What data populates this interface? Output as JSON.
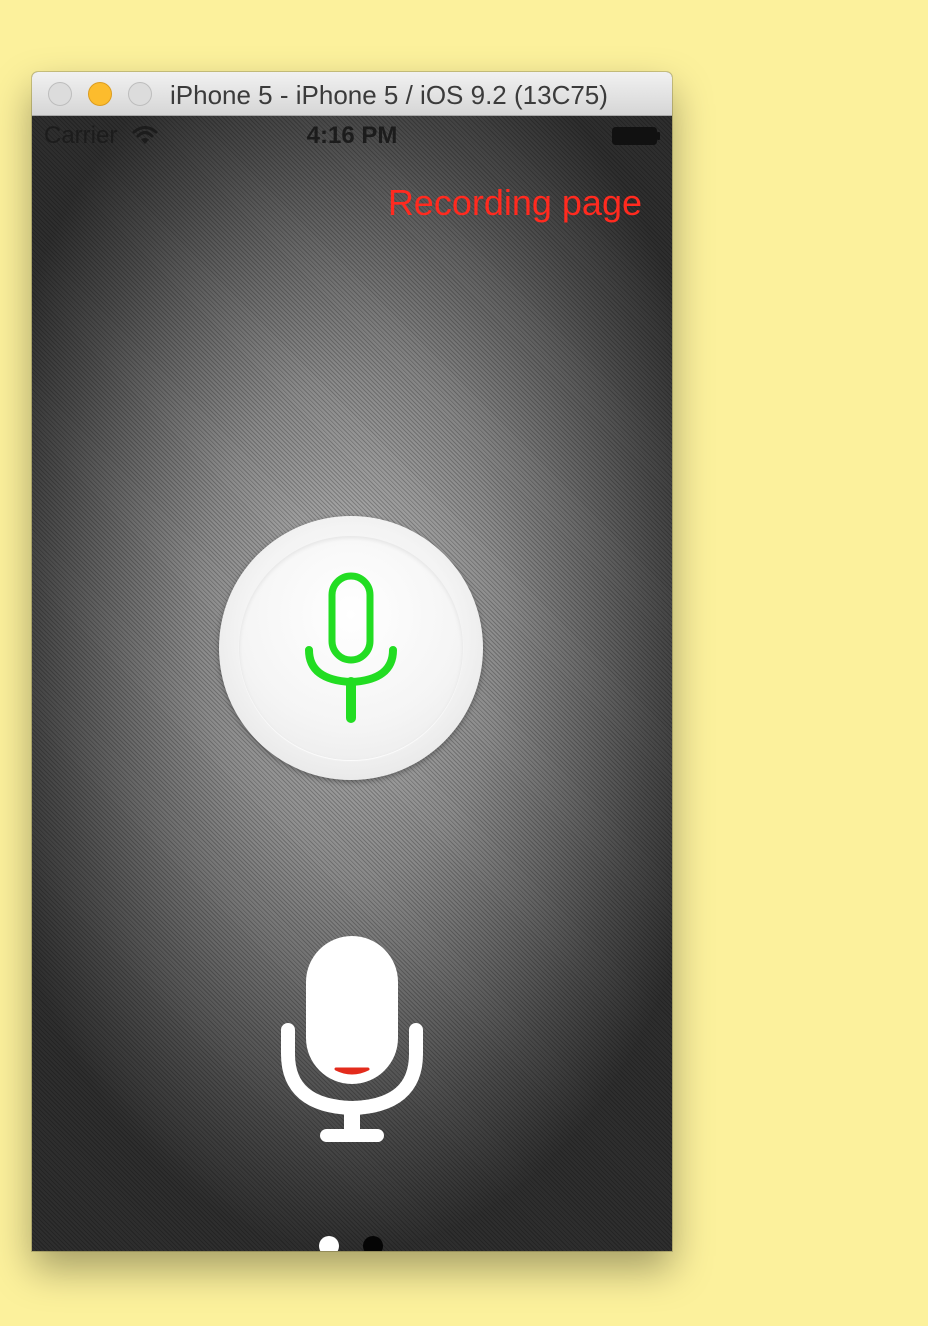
{
  "window": {
    "title": "iPhone 5 - iPhone 5 / iOS 9.2 (13C75)"
  },
  "status_bar": {
    "carrier": "Carrier",
    "time": "4:16 PM",
    "wifi_icon": "wifi-icon",
    "battery_icon": "battery-icon"
  },
  "screen": {
    "title": "Recording page",
    "title_color": "#ff2a1f",
    "record_button_icon": "microphone-icon",
    "record_button_icon_color": "#22dd22",
    "large_mic_icon": "microphone-icon",
    "large_mic_level_color": "#e32b1c"
  },
  "page_control": {
    "page_count": 2,
    "current_page": 1
  },
  "colors": {
    "desktop_background": "#fcf19c",
    "minimize_button": "#fcbc2d"
  }
}
